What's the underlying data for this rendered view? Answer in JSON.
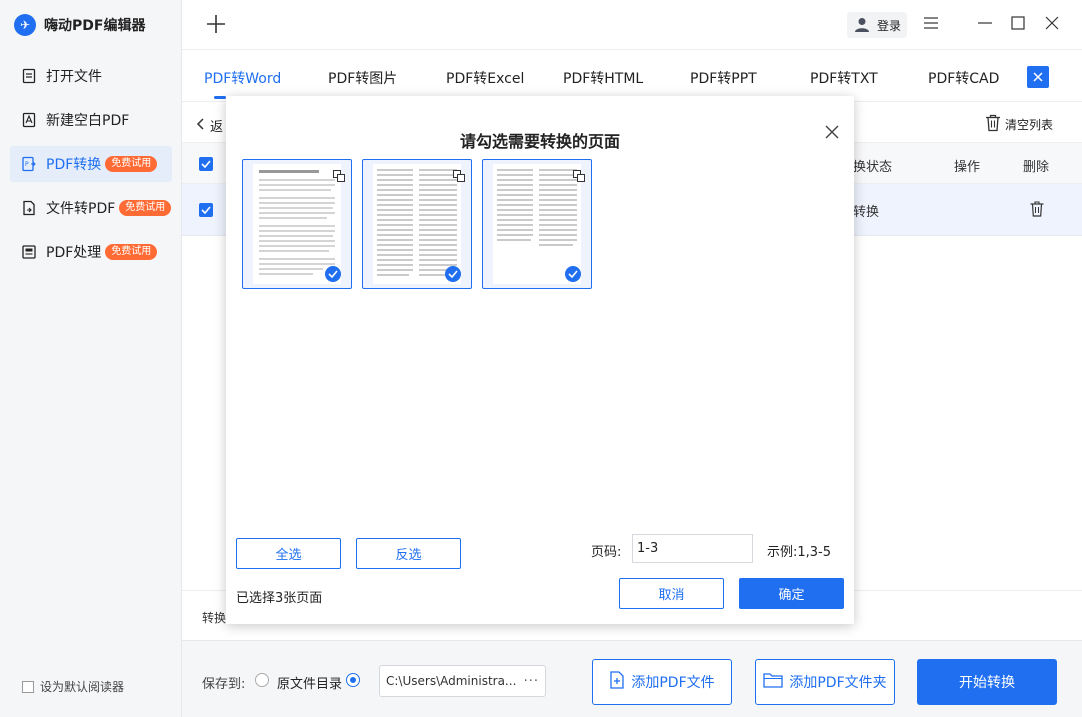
{
  "app": {
    "name": "嗨动PDF编辑器",
    "logo_glyph": "✈"
  },
  "sidebar": {
    "items": [
      {
        "label": "打开文件",
        "icon": "open-file-icon"
      },
      {
        "label": "新建空白PDF",
        "icon": "new-pdf-icon"
      },
      {
        "label": "PDF转换",
        "icon": "pdf-convert-icon",
        "badge": "免费试用"
      },
      {
        "label": "文件转PDF",
        "icon": "file-to-pdf-icon",
        "badge": "免费试用"
      },
      {
        "label": "PDF处理",
        "icon": "pdf-process-icon",
        "badge": "免费试用"
      }
    ],
    "default_reader": "设为默认阅读器"
  },
  "topbar": {
    "login": "登录"
  },
  "tabs": [
    {
      "label": "PDF转Word"
    },
    {
      "label": "PDF转图片"
    },
    {
      "label": "PDF转Excel"
    },
    {
      "label": "PDF转HTML"
    },
    {
      "label": "PDF转PPT"
    },
    {
      "label": "PDF转TXT"
    },
    {
      "label": "PDF转CAD"
    }
  ],
  "main": {
    "back": "返",
    "clear_list": "清空列表",
    "columns": {
      "status": "换状态",
      "action": "操作",
      "delete": "删除"
    },
    "row": {
      "status": "转换"
    },
    "bottom_label": "转换"
  },
  "footer": {
    "save_to": "保存到:",
    "original_dir": "原文件目录",
    "path": "C:\\Users\\Administra...",
    "path_more": "···",
    "add_file": "添加PDF文件",
    "add_folder": "添加PDF文件夹",
    "start": "开始转换"
  },
  "dialog": {
    "title": "请勾选需要转换的页面",
    "select_all": "全选",
    "invert": "反选",
    "page_label": "页码:",
    "page_value": "1-3",
    "example": "示例:1,3-5",
    "selected": "已选择3张页面",
    "cancel": "取消",
    "confirm": "确定",
    "pages": [
      {
        "selected": true
      },
      {
        "selected": true
      },
      {
        "selected": true
      }
    ]
  },
  "colors": {
    "accent": "#1f6ff0",
    "badge": "#ff6b35"
  }
}
